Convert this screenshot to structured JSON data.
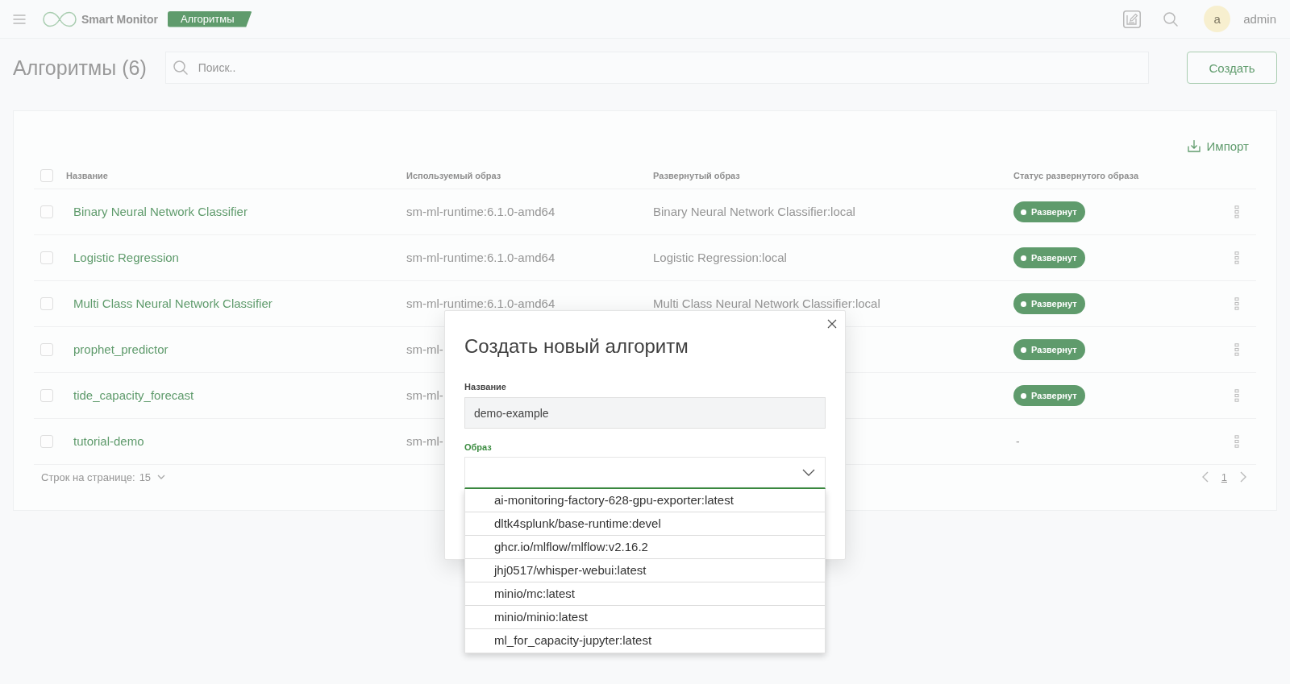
{
  "app_bar": {
    "logo_text": "Smart Monitor",
    "section_tag": "Алгоритмы",
    "user": {
      "avatar_letter": "a",
      "name": "admin"
    }
  },
  "page_header": {
    "title": "Алгоритмы (6)",
    "search": {
      "placeholder": "Поиск.."
    },
    "create_button": "Создать"
  },
  "table": {
    "import_button": "Импорт",
    "select_all": {
      "checked": false
    },
    "columns": [
      "Название",
      "Используемый образ",
      "Развернутый образ",
      "Статус развернутого образа"
    ],
    "rows": [
      {
        "checked": false,
        "name": "Binary Neural Network Classifier",
        "image": "sm-ml-runtime:6.1.0-amd64",
        "deployed_image": "Binary Neural Network Classifier:local",
        "status": {
          "kind": "badge",
          "text": "Развернут"
        }
      },
      {
        "checked": false,
        "name": "Logistic Regression",
        "image": "sm-ml-runtime:6.1.0-amd64",
        "deployed_image": "Logistic Regression:local",
        "status": {
          "kind": "badge",
          "text": "Развернут"
        }
      },
      {
        "checked": false,
        "name": "Multi Class Neural Network Classifier",
        "image": "sm-ml-runtime:6.1.0-amd64",
        "deployed_image": "Multi Class Neural Network Classifier:local",
        "status": {
          "kind": "badge",
          "text": "Развернут"
        }
      },
      {
        "checked": false,
        "name": "prophet_predictor",
        "image": "sm-ml-",
        "status": {
          "kind": "badge",
          "text": "Развернут"
        }
      },
      {
        "checked": false,
        "name": "tide_capacity_forecast",
        "image": "sm-ml-",
        "status": {
          "kind": "badge",
          "text": "Развернут"
        }
      },
      {
        "checked": false,
        "name": "tutorial-demo",
        "image": "sm-ml-",
        "status": {
          "kind": "plain",
          "text": "-"
        }
      }
    ]
  },
  "pagination": {
    "rows_per_page_label": "Строк на странице:",
    "rows_per_page": "15",
    "pages": [
      {
        "label": "1",
        "selected": true
      }
    ]
  },
  "modal": {
    "title": "Создать новый алгоритм",
    "fields": [
      {
        "kind": "text",
        "label": "Название",
        "value": "demo-example",
        "focused": false
      },
      {
        "kind": "select",
        "label": "Образ",
        "focused": true,
        "expanded": true,
        "options": [
          {
            "label": "ai-monitoring-factory-628-gpu-exporter:latest",
            "selected": false
          },
          {
            "label": "dltk4splunk/base-runtime:devel",
            "selected": false
          },
          {
            "label": "ghcr.io/mlflow/mlflow:v2.16.2",
            "selected": false
          },
          {
            "label": "jhj0517/whisper-webui:latest",
            "selected": false
          },
          {
            "label": "minio/mc:latest",
            "selected": false
          },
          {
            "label": "minio/minio:latest",
            "selected": false
          },
          {
            "label": "ml_for_capacity-jupyter:latest",
            "selected": false
          }
        ]
      }
    ]
  }
}
